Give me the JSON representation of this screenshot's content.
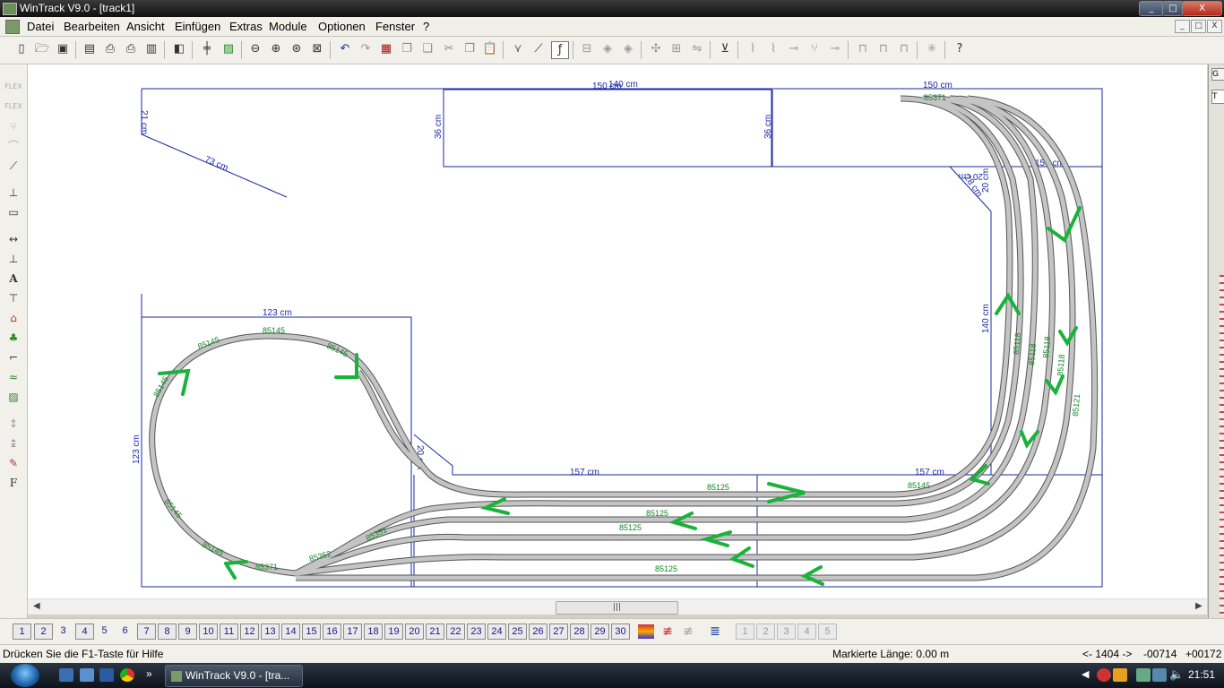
{
  "window": {
    "title": "WinTrack  V9.0 - [track1]",
    "controls": {
      "minimize": "_",
      "maximize": "□",
      "close": "X"
    }
  },
  "menu": {
    "items": [
      "Datei",
      "Bearbeiten",
      "Ansicht",
      "Einfügen",
      "Extras",
      "Module",
      "Optionen",
      "Fenster",
      "?"
    ]
  },
  "toolbar": {
    "icons": [
      "new-icon",
      "open-icon",
      "save-icon",
      "print-preview-icon",
      "print-icon",
      "printer-setup-icon",
      "page-icon",
      "export-icon",
      "grid-icon",
      "picture-icon",
      "zoom-out-icon",
      "zoom-in-icon",
      "zoom-window-icon",
      "zoom-all-icon",
      "undo-icon",
      "redo-icon",
      "parts-list-icon",
      "copy-icon",
      "paste-icon",
      "cut-icon",
      "duplicate-icon",
      "clipboard-icon",
      "flex-track-icon",
      "curve-icon",
      "draw-icon",
      "rail-icon",
      "group-icon",
      "ungroup-icon",
      "rotate-icon",
      "align-icon",
      "mirror-icon",
      "connect-icon",
      "split-icon",
      "measure-icon",
      "height-icon",
      "settings-icon",
      "help-icon"
    ]
  },
  "layout": {
    "dimensions": [
      "21 cm",
      "73 cm",
      "150 cm",
      "140 cm",
      "36 cm",
      "36 cm",
      "150 cm",
      "20 cm",
      "20 cm",
      "28 cm",
      "150 cm",
      "140 cm",
      "123 cm",
      "123 cm",
      "157 cm",
      "157 cm",
      "20 cm"
    ],
    "track_labels": [
      "85145",
      "85145",
      "85145",
      "85145",
      "85145",
      "85145",
      "85145",
      "85371",
      "85371",
      "85125",
      "85125",
      "85125",
      "85125",
      "85352",
      "85351",
      "85118",
      "85118",
      "85118",
      "85118",
      "85121"
    ]
  },
  "layers": {
    "buttons": [
      "1",
      "2",
      "3",
      "4",
      "5",
      "6",
      "7",
      "8",
      "9",
      "10",
      "11",
      "12",
      "13",
      "14",
      "15",
      "16",
      "17",
      "18",
      "19",
      "20",
      "21",
      "22",
      "23",
      "24",
      "25",
      "26",
      "27",
      "28",
      "29",
      "30"
    ],
    "extra": [
      "1",
      "2",
      "3",
      "4",
      "5"
    ]
  },
  "status": {
    "help": "Drücken Sie die  F1-Taste für Hilfe",
    "marked_length": "Markierte Länge: 0.00 m",
    "coord_x_label": "<- 1404 ->",
    "coord_y": "-00714",
    "coord_z": "+00172"
  },
  "taskbar": {
    "task_label": "WinTrack  V9.0 - [tra...",
    "clock": "21:51",
    "more": "»"
  },
  "colors": {
    "dimension_blue": "#1a2aa0",
    "track_fill": "#c0c0c0",
    "track_edge": "#555555",
    "label_green": "#118822",
    "arrow_green": "#19b33a"
  }
}
